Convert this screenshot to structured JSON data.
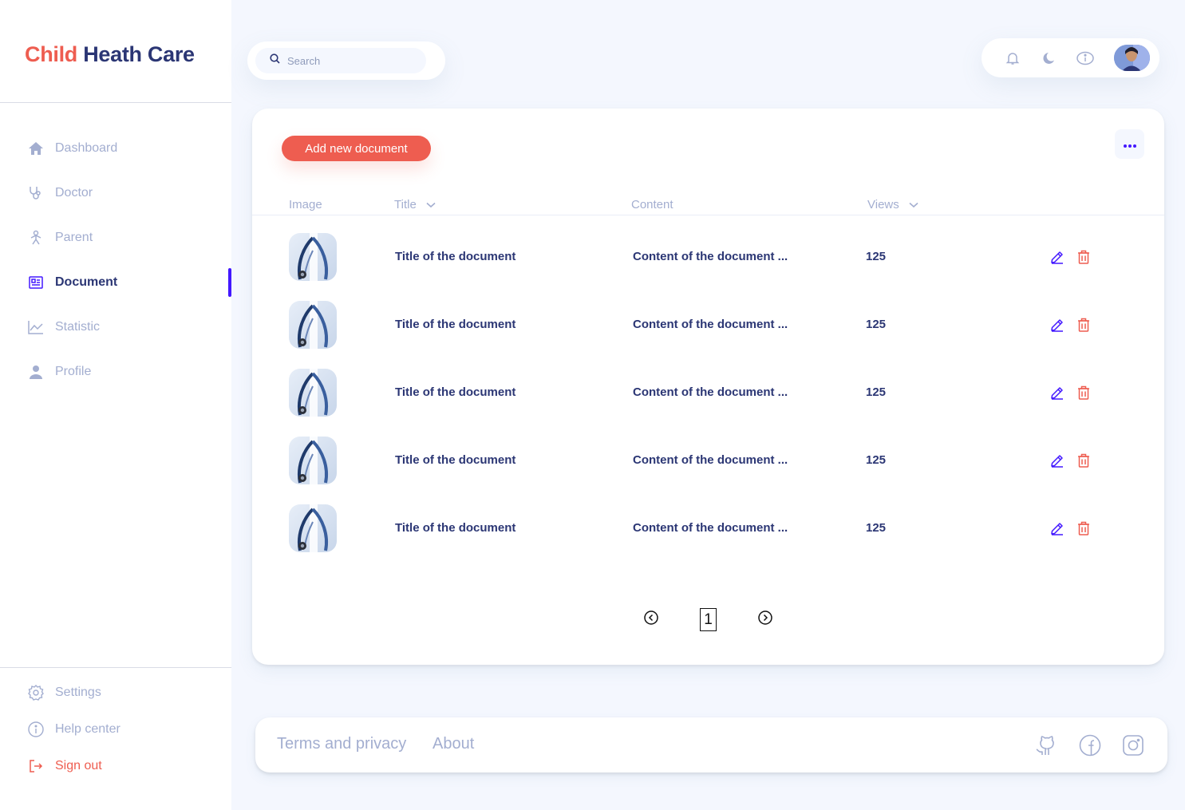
{
  "brand": {
    "part1": "Child",
    "part2": "Heath Care"
  },
  "sidebar": {
    "items": [
      {
        "label": "Dashboard",
        "icon": "home-icon"
      },
      {
        "label": "Doctor",
        "icon": "stethoscope-icon"
      },
      {
        "label": "Parent",
        "icon": "person-icon"
      },
      {
        "label": "Document",
        "icon": "document-icon",
        "active": true
      },
      {
        "label": "Statistic",
        "icon": "chart-line-icon"
      },
      {
        "label": "Profile",
        "icon": "user-icon"
      }
    ],
    "bottom": [
      {
        "label": "Settings",
        "icon": "gear-icon"
      },
      {
        "label": "Help center",
        "icon": "info-icon"
      },
      {
        "label": "Sign out",
        "icon": "sign-out-icon"
      }
    ]
  },
  "search": {
    "placeholder": "Search",
    "value": ""
  },
  "topbar": {
    "icons": [
      "bell-icon",
      "moon-icon",
      "info-icon"
    ]
  },
  "main": {
    "add_button": "Add new document",
    "columns": {
      "image": "Image",
      "title": "Title",
      "content": "Content",
      "views": "Views"
    },
    "rows": [
      {
        "title": "Title of the document",
        "content": "Content of the document ...",
        "views": "125"
      },
      {
        "title": "Title of the document",
        "content": "Content of the document ...",
        "views": "125"
      },
      {
        "title": "Title of the document",
        "content": "Content of the document ...",
        "views": "125"
      },
      {
        "title": "Title of the document",
        "content": "Content of the document ...",
        "views": "125"
      },
      {
        "title": "Title of the document",
        "content": "Content of the document ...",
        "views": "125"
      }
    ],
    "pagination": {
      "current": "1"
    }
  },
  "footer": {
    "links": [
      "Terms and privacy",
      "About"
    ],
    "social": [
      "github-icon",
      "facebook-icon",
      "instagram-icon"
    ]
  },
  "colors": {
    "accent": "#4318ff",
    "brand_red": "#ee5d50",
    "navy": "#2b3674",
    "muted": "#a3aed0",
    "background": "#f4f7fe"
  }
}
